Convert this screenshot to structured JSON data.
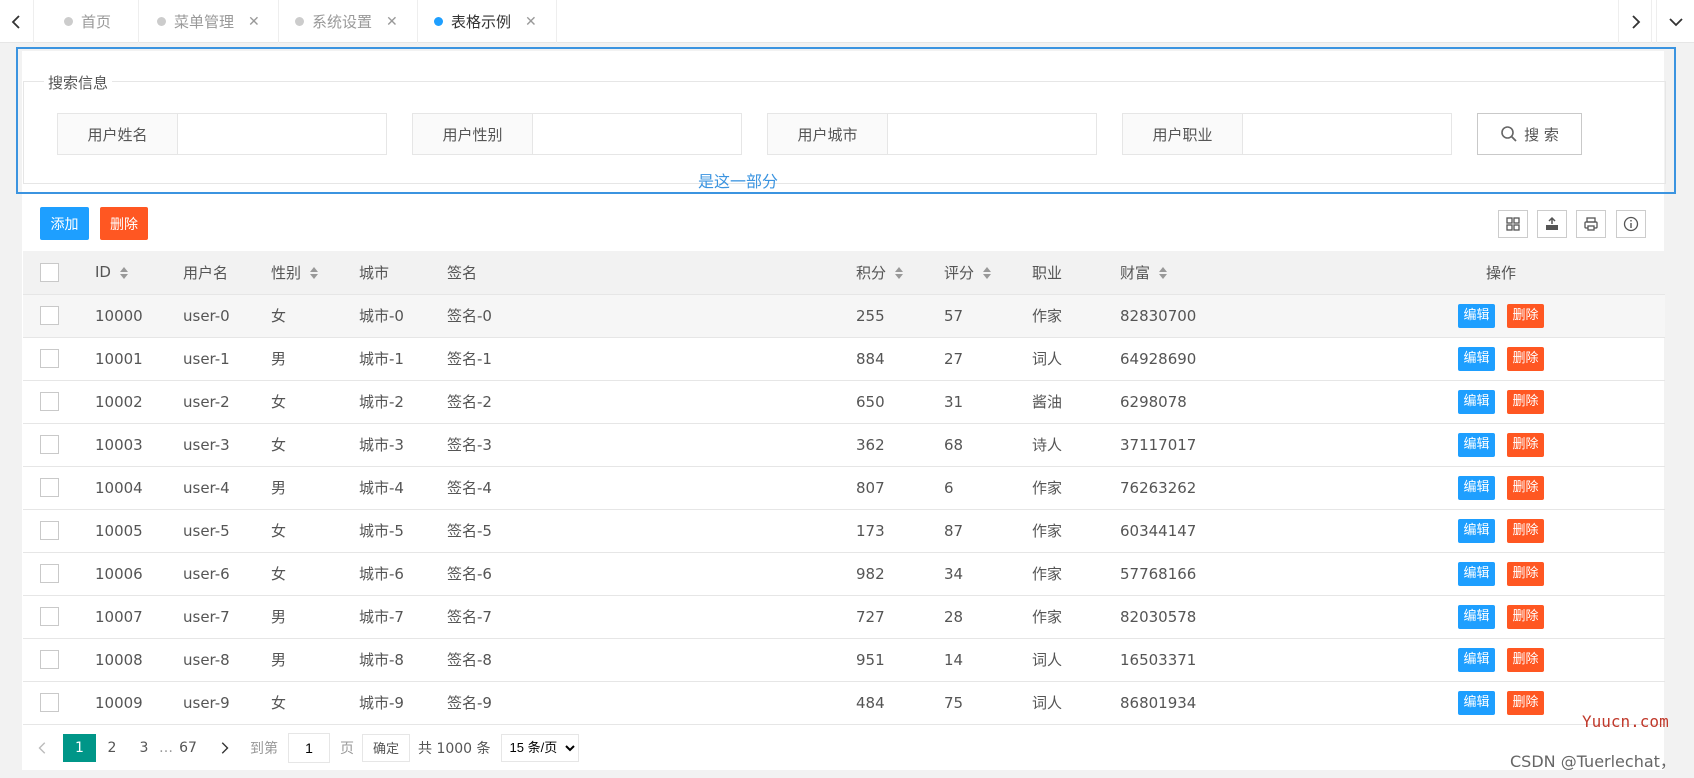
{
  "tabs": [
    {
      "label": "首页",
      "closable": false,
      "active": false
    },
    {
      "label": "菜单管理",
      "closable": true,
      "active": false
    },
    {
      "label": "系统设置",
      "closable": true,
      "active": false
    },
    {
      "label": "表格示例",
      "closable": true,
      "active": true
    }
  ],
  "search": {
    "legend": "搜索信息",
    "fields": [
      {
        "label": "用户姓名",
        "value": ""
      },
      {
        "label": "用户性别",
        "value": ""
      },
      {
        "label": "用户城市",
        "value": ""
      },
      {
        "label": "用户职业",
        "value": ""
      }
    ],
    "button": "搜 索",
    "note": "是这一部分"
  },
  "toolbar": {
    "add": "添加",
    "delete": "删除"
  },
  "table": {
    "headers": [
      "ID",
      "用户名",
      "性别",
      "城市",
      "签名",
      "积分",
      "评分",
      "职业",
      "财富",
      "操作"
    ],
    "rows": [
      [
        "10000",
        "user-0",
        "女",
        "城市-0",
        "签名-0",
        "255",
        "57",
        "作家",
        "82830700"
      ],
      [
        "10001",
        "user-1",
        "男",
        "城市-1",
        "签名-1",
        "884",
        "27",
        "词人",
        "64928690"
      ],
      [
        "10002",
        "user-2",
        "女",
        "城市-2",
        "签名-2",
        "650",
        "31",
        "酱油",
        "6298078"
      ],
      [
        "10003",
        "user-3",
        "女",
        "城市-3",
        "签名-3",
        "362",
        "68",
        "诗人",
        "37117017"
      ],
      [
        "10004",
        "user-4",
        "男",
        "城市-4",
        "签名-4",
        "807",
        "6",
        "作家",
        "76263262"
      ],
      [
        "10005",
        "user-5",
        "女",
        "城市-5",
        "签名-5",
        "173",
        "87",
        "作家",
        "60344147"
      ],
      [
        "10006",
        "user-6",
        "女",
        "城市-6",
        "签名-6",
        "982",
        "34",
        "作家",
        "57768166"
      ],
      [
        "10007",
        "user-7",
        "男",
        "城市-7",
        "签名-7",
        "727",
        "28",
        "作家",
        "82030578"
      ],
      [
        "10008",
        "user-8",
        "男",
        "城市-8",
        "签名-8",
        "951",
        "14",
        "词人",
        "16503371"
      ],
      [
        "10009",
        "user-9",
        "女",
        "城市-9",
        "签名-9",
        "484",
        "75",
        "词人",
        "86801934"
      ]
    ],
    "edit_label": "编辑",
    "delete_label": "删除"
  },
  "pager": {
    "pages": [
      "1",
      "2",
      "3",
      "67"
    ],
    "ellipsis": "…",
    "goto": "到第",
    "current": "1",
    "page_unit": "页",
    "confirm": "确定",
    "total": "共 1000 条",
    "per_page": "15 条/页"
  },
  "watermarks": {
    "site": "Yuucn.com",
    "author": "CSDN @Tuerlechat，"
  },
  "colors": {
    "accent": "#1e9fff",
    "danger": "#ff5722",
    "current_page": "#009688",
    "highlight": "#3b94e0"
  }
}
